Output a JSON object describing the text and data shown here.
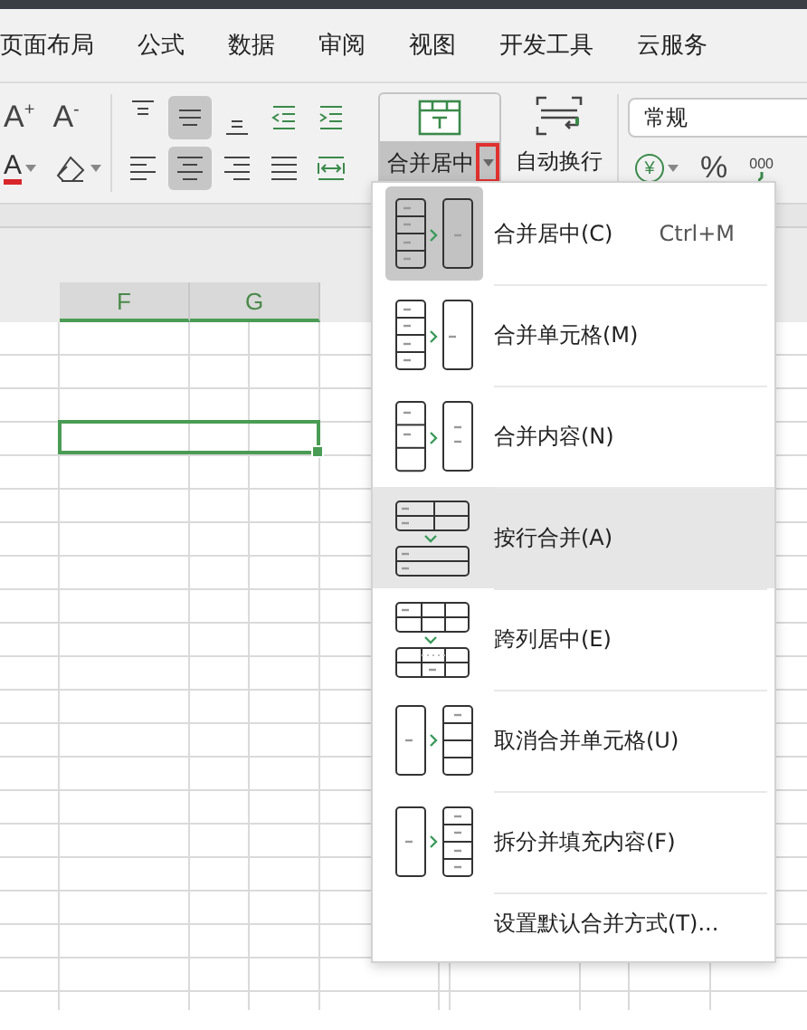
{
  "menu_tabs": [
    {
      "label": "页面布局"
    },
    {
      "label": "公式"
    },
    {
      "label": "数据"
    },
    {
      "label": "审阅"
    },
    {
      "label": "视图"
    },
    {
      "label": "开发工具"
    },
    {
      "label": "云服务"
    }
  ],
  "ribbon": {
    "font_buttons": [
      {
        "label": "A$^{+}$"
      },
      {
        "label": "A$^{-}$"
      }
    ],
    "font_color": {
      "label": "A"
    },
    "align_buttons": [
      {
        "kind": "top",
        "on": false
      },
      {
        "kind": "middle",
        "on": true
      },
      {
        "kind": "bottom",
        "on": false
      },
      {
        "kind": "indent-decrease",
        "on": false
      },
      {
        "kind": "indent-increase",
        "on": false
      },
      {
        "kind": "left",
        "on": false
      },
      {
        "kind": "center",
        "on": true
      },
      {
        "kind": "right",
        "on": false
      },
      {
        "kind": "justify",
        "on": false
      },
      {
        "kind": "distributed",
        "on": false
      }
    ],
    "merge_button": {
      "label": "合并居中",
      "pressed": true,
      "dropdown_highlighted": true
    },
    "wrap_button": {
      "label": "自动换行"
    },
    "number_format": {
      "value": "常规"
    },
    "number_buttons": [
      {
        "kind": "currency",
        "label": "¥"
      },
      {
        "kind": "percent",
        "label": "%"
      },
      {
        "kind": "thousands",
        "label": "000"
      }
    ]
  },
  "sheet": {
    "columns": [
      "F",
      "G"
    ]
  },
  "merge_menu": {
    "items": [
      {
        "kind": "merge-center",
        "label": "合并居中(C)",
        "shortcut": "Ctrl+M",
        "selected": true,
        "highlighted": false
      },
      {
        "kind": "merge-cells",
        "label": "合并单元格(M)",
        "selected": false,
        "highlighted": false
      },
      {
        "kind": "merge-content",
        "label": "合并内容(N)",
        "selected": false,
        "highlighted": false
      },
      {
        "kind": "merge-rows",
        "label": "按行合并(A)",
        "selected": false,
        "highlighted": true
      },
      {
        "kind": "center-across",
        "label": "跨列居中(E)",
        "selected": false,
        "highlighted": false
      },
      {
        "kind": "unmerge",
        "label": "取消合并单元格(U)",
        "selected": false,
        "highlighted": false
      },
      {
        "kind": "split-fill",
        "label": "拆分并填充内容(F)",
        "selected": false,
        "highlighted": false
      },
      {
        "kind": "setting",
        "label": "设置默认合并方式(T)...",
        "highlighted": false
      }
    ]
  }
}
